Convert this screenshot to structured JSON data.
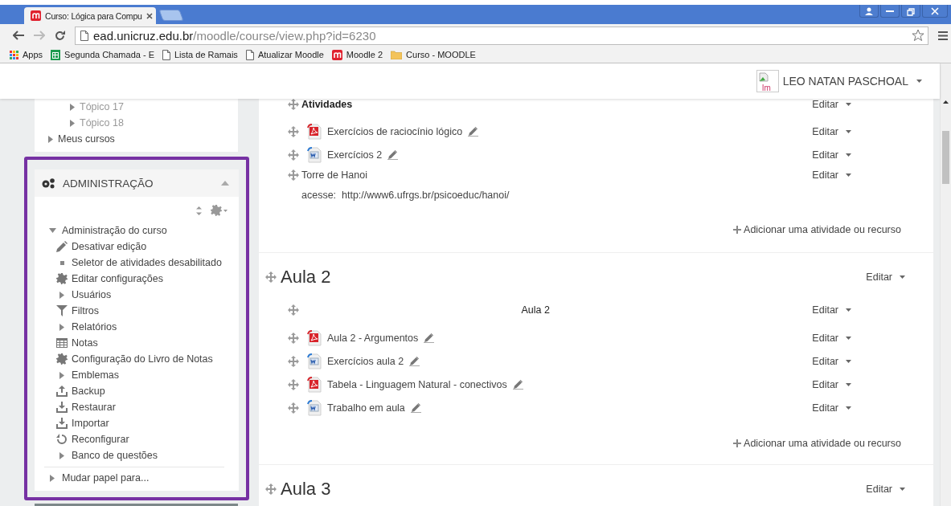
{
  "browser": {
    "tab_title": "Curso: Lógica para Compu",
    "address": {
      "host": "ead.unicruz.edu.br",
      "path": "/moodle/course/view.php?id=6230"
    },
    "bookmarks": [
      {
        "label": "Apps",
        "kind": "apps"
      },
      {
        "label": "Segunda Chamada - E",
        "kind": "sheet"
      },
      {
        "label": "Lista de Ramais",
        "kind": "page"
      },
      {
        "label": "Atualizar Moodle",
        "kind": "page"
      },
      {
        "label": "Moodle 2",
        "kind": "moodle"
      },
      {
        "label": "Curso - MOODLE",
        "kind": "folder"
      }
    ]
  },
  "navbar": {
    "avatar_alt": "Im",
    "user_name": "LEO NATAN PASCHOAL"
  },
  "navigation": {
    "course_topics": [
      {
        "label": "Tópico 17",
        "expanded": false
      },
      {
        "label": "Tópico 18",
        "expanded": false
      }
    ],
    "items": [
      {
        "label": "Meus cursos",
        "expanded": false
      }
    ]
  },
  "administration": {
    "title": "ADMINISTRAÇÃO",
    "tree": [
      {
        "label": "Administração do curso",
        "kind": "branch",
        "expanded": true,
        "children": [
          {
            "label": "Desativar edição",
            "kind": "pencil"
          },
          {
            "label": "Seletor de atividades desabilitado",
            "kind": "bullet"
          },
          {
            "label": "Editar configurações",
            "kind": "gear"
          },
          {
            "label": "Usuários",
            "kind": "branch",
            "expanded": false
          },
          {
            "label": "Filtros",
            "kind": "filter"
          },
          {
            "label": "Relatórios",
            "kind": "branch",
            "expanded": false
          },
          {
            "label": "Notas",
            "kind": "table"
          },
          {
            "label": "Configuração do Livro de Notas",
            "kind": "gear"
          },
          {
            "label": "Emblemas",
            "kind": "branch",
            "expanded": false
          },
          {
            "label": "Backup",
            "kind": "upload"
          },
          {
            "label": "Restaurar",
            "kind": "download"
          },
          {
            "label": "Importar",
            "kind": "download"
          },
          {
            "label": "Reconfigurar",
            "kind": "refresh"
          },
          {
            "label": "Banco de questões",
            "kind": "branch",
            "expanded": false
          }
        ]
      },
      {
        "label": "Mudar papel para...",
        "kind": "branch",
        "expanded": false
      }
    ]
  },
  "sections": [
    {
      "items": [
        {
          "kind": "heading",
          "text": "Atividades",
          "edit": "Editar"
        },
        {
          "kind": "pdf",
          "text": "Exercícios de raciocínio lógico",
          "edit": "Editar"
        },
        {
          "kind": "doc",
          "text": "Exercícios 2",
          "edit": "Editar"
        },
        {
          "kind": "label",
          "text": "Torre de Hanoi",
          "edit": "Editar",
          "description": "acesse:  http://www6.ufrgs.br/psicoeduc/hanoi/"
        }
      ],
      "add": "Adicionar uma atividade ou recurso"
    },
    {
      "title": "Aula 2",
      "edit": "Editar",
      "items": [
        {
          "kind": "centered",
          "text": "Aula 2",
          "edit": "Editar"
        },
        {
          "kind": "pdf",
          "text": "Aula 2 - Argumentos",
          "edit": "Editar"
        },
        {
          "kind": "doc",
          "text": "Exercícios aula 2",
          "edit": "Editar"
        },
        {
          "kind": "pdf",
          "text": "Tabela - Linguagem Natural - conectivos",
          "edit": "Editar"
        },
        {
          "kind": "doc",
          "text": "Trabalho em aula",
          "edit": "Editar"
        }
      ],
      "add": "Adicionar uma atividade ou recurso"
    },
    {
      "title": "Aula 3",
      "edit": "Editar"
    }
  ]
}
